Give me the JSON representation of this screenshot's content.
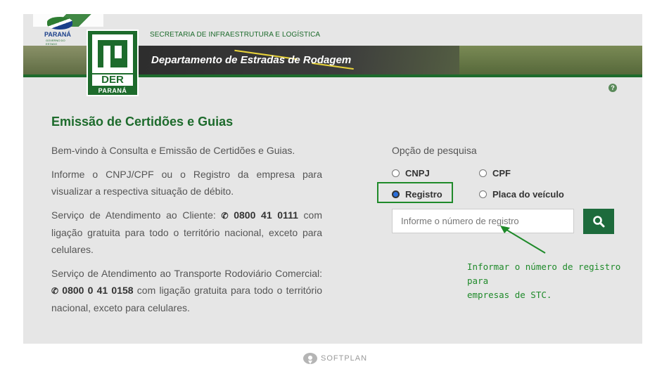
{
  "header": {
    "secretaria": "SECRETARIA DE INFRAESTRUTURA E LOGÍSTICA",
    "department": "Departamento de Estradas de Rodagem",
    "parana_logo_text": "PARANÁ",
    "parana_logo_sub": "GOVERNO DO ESTADO",
    "der_logo_text": "DER",
    "der_logo_sub": "PARANÁ"
  },
  "help_icon": "?",
  "main": {
    "title": "Emissão de Certidões e Guias",
    "welcome": "Bem-vindo à Consulta e Emissão de Certidões e Guias.",
    "instruction": "Informe o CNPJ/CPF ou o Registro da empresa para visualizar a respectiva situação de débito.",
    "service1_prefix": "Serviço de Atendimento ao Cliente: ",
    "service1_phone": "0800 41 0111",
    "service1_suffix": " com ligação gratuita para todo o território nacional, exceto para celulares.",
    "service2_prefix": "Serviço de Atendimento ao Transporte Rodoviário Comercial: ",
    "service2_phone": "0800 0 41 0158",
    "service2_suffix": " com ligação gratuita para todo o território nacional, exceto para celulares.",
    "phone_icon": "phone-icon"
  },
  "search": {
    "option_label": "Opção de pesquisa",
    "options": [
      {
        "label": "CNPJ",
        "checked": false
      },
      {
        "label": "CPF",
        "checked": false
      },
      {
        "label": "Registro",
        "checked": true
      },
      {
        "label": "Placa do veículo",
        "checked": false
      }
    ],
    "placeholder": "Informe o número de registro",
    "button_icon": "search-icon"
  },
  "annotation": {
    "line1": "Informar o número de registro para",
    "line2": "empresas de STC.",
    "color": "#1f8a2a"
  },
  "footer": {
    "brand": "SOFTPLAN"
  },
  "colors": {
    "brand_green": "#1d6b2c",
    "button_green": "#1d6b3c",
    "radio_selected": "#2a6fdb"
  }
}
